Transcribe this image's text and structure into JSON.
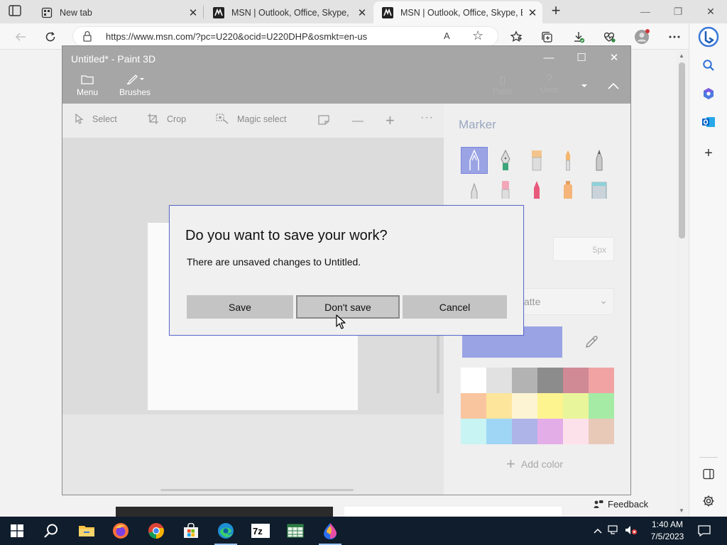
{
  "browser": {
    "tabs": [
      {
        "title": "New tab",
        "active": false
      },
      {
        "title": "MSN | Outlook, Office, Skype, Bi",
        "active": false
      },
      {
        "title": "MSN | Outlook, Office, Skype, Bi",
        "active": true
      }
    ],
    "tab_close_glyph": "✕",
    "new_tab_glyph": "+",
    "window_controls": {
      "minimize": "—",
      "restore": "❐",
      "close": "✕"
    },
    "address": {
      "url": "https://www.msn.com/?pc=U220&ocid=U220DHP&osmkt=en-us",
      "read_aloud": "A"
    },
    "feedback_label": "Feedback"
  },
  "paint": {
    "window_title": "Untitled* - Paint 3D",
    "window_controls": {
      "minimize": "—",
      "maximize": "☐",
      "close": "✕"
    },
    "ribbon": {
      "menu_label": "Menu",
      "brushes_label": "Brushes",
      "paste_label": "Paste",
      "undo_label": "Undo"
    },
    "toolbar": {
      "select_label": "Select",
      "crop_label": "Crop",
      "magic_select_label": "Magic select"
    },
    "panel": {
      "title": "Marker",
      "thickness_value": "5px",
      "finish_value": "atte",
      "selected_color": "#9aa3e4",
      "add_color_label": "Add color",
      "palette": [
        "#ffffff",
        "#e1e1e1",
        "#b3b3b3",
        "#8c8c8c",
        "#d08a96",
        "#f1a3a3",
        "#f9c59f",
        "#fde59b",
        "#fdf4d3",
        "#fdf48f",
        "#e9f59a",
        "#a5eba5",
        "#c9f4f4",
        "#9fd6f5",
        "#aeb3e8",
        "#e3ade8",
        "#fde1ea",
        "#e8c9b8"
      ]
    }
  },
  "dialog": {
    "title": "Do you want to save your work?",
    "message": "There are unsaved changes to Untitled.",
    "save_label": "Save",
    "dont_save_label": "Don't save",
    "cancel_label": "Cancel"
  },
  "taskbar": {
    "time": "1:40 AM",
    "date": "7/5/2023"
  }
}
